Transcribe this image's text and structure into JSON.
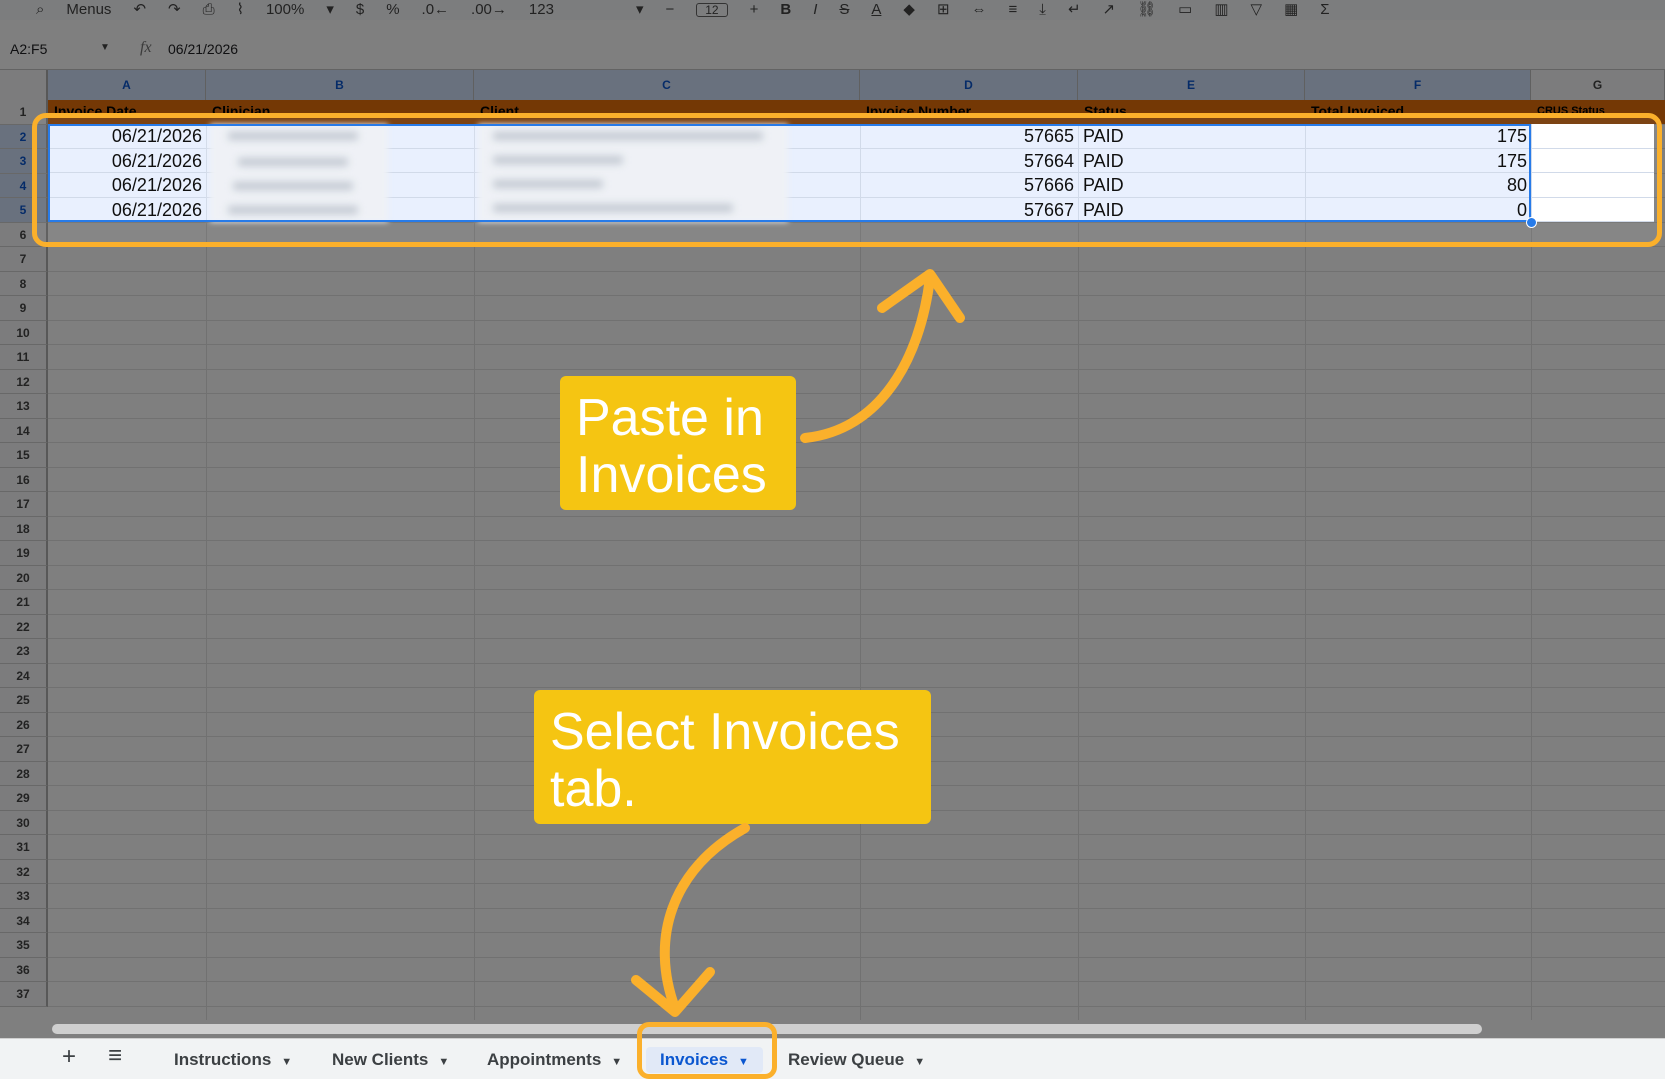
{
  "toolbar": {
    "search_label": "Menus",
    "zoom": "100%",
    "percent": "%",
    "number_format": "123",
    "font_size": "12",
    "bold": "B",
    "italic": "I",
    "text_color": "A",
    "function": "Σ"
  },
  "formula_bar": {
    "name_box": "A2:F5",
    "fx": "fx",
    "value": "06/21/2026"
  },
  "columns": [
    "A",
    "B",
    "C",
    "D",
    "E",
    "F",
    "G"
  ],
  "header_cells": [
    "Invoice Date",
    "Clinician",
    "Client",
    "Invoice Number",
    "Status",
    "Total Invoiced",
    "CRUS Status"
  ],
  "rows": [
    {
      "date": "06/21/2026",
      "invoice": "57665",
      "status": "PAID",
      "total": "175"
    },
    {
      "date": "06/21/2026",
      "invoice": "57664",
      "status": "PAID",
      "total": "175"
    },
    {
      "date": "06/21/2026",
      "invoice": "57666",
      "status": "PAID",
      "total": "80"
    },
    {
      "date": "06/21/2026",
      "invoice": "57667",
      "status": "PAID",
      "total": "0"
    }
  ],
  "row_numbers": [
    "1",
    "2",
    "3",
    "4",
    "5",
    "6",
    "7",
    "8",
    "9",
    "10",
    "11",
    "12",
    "13",
    "14",
    "15",
    "16",
    "17",
    "18",
    "19",
    "20",
    "21",
    "22",
    "23",
    "24",
    "25",
    "26",
    "27",
    "28",
    "29",
    "30",
    "31",
    "32",
    "33",
    "34",
    "35",
    "36",
    "37"
  ],
  "sheet_tabs": {
    "add": "+",
    "menu": "≡",
    "tabs": [
      {
        "label": "Instructions",
        "caret": "▼"
      },
      {
        "label": "New Clients",
        "caret": "▼"
      },
      {
        "label": "Appointments",
        "caret": "▼"
      },
      {
        "label": "Invoices",
        "caret": "▼"
      },
      {
        "label": "Review Queue",
        "caret": "▼"
      }
    ]
  },
  "callouts": {
    "paste": "Paste in Invoices",
    "select": "Select Invoices tab."
  },
  "colors": {
    "accent": "#f5c512",
    "highlight": "#fbb02b",
    "header_orange": "#e8710a",
    "selection": "#1a73e8"
  }
}
